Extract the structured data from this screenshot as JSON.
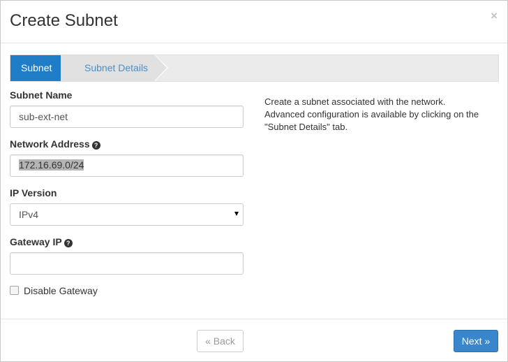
{
  "modal": {
    "title": "Create Subnet",
    "close": "×"
  },
  "wizard": {
    "steps": [
      {
        "label": "Subnet",
        "active": true
      },
      {
        "label": "Subnet Details",
        "active": false
      }
    ]
  },
  "form": {
    "subnet_name": {
      "label": "Subnet Name",
      "value": "sub-ext-net"
    },
    "network_address": {
      "label": "Network Address",
      "value": "172.16.69.0/24"
    },
    "ip_version": {
      "label": "IP Version",
      "value": "IPv4"
    },
    "gateway_ip": {
      "label": "Gateway IP",
      "value": ""
    },
    "disable_gateway": {
      "label": "Disable Gateway",
      "checked": false
    }
  },
  "help_text": "Create a subnet associated with the network. Advanced configuration is available by clicking on the \"Subnet Details\" tab.",
  "footer": {
    "back_label": "« Back",
    "next_label": "Next »"
  },
  "colors": {
    "primary": "#1e7dc6",
    "next_button": "#3a86cc",
    "inactive_step_text": "#4a90c8"
  },
  "icons": {
    "help": "question-circle-icon",
    "close": "close-icon",
    "select": "chevron-down-icon"
  }
}
